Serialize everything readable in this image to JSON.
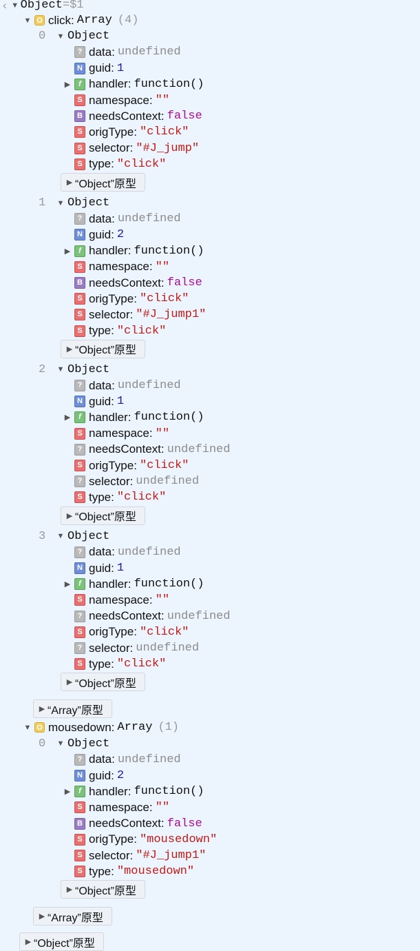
{
  "root": {
    "back_glyph": "‹",
    "label": "Object",
    "eq": "=",
    "var": "$1"
  },
  "groups": [
    {
      "name": "click",
      "type_label": "Array",
      "count": "(4)",
      "objects": [
        {
          "index": "0",
          "label": "Object",
          "props": [
            {
              "badge": "u",
              "key": "data:",
              "value": "undefined",
              "vclass": "v-undef"
            },
            {
              "badge": "N",
              "key": "guid:",
              "value": "1",
              "vclass": "v-num"
            },
            {
              "badge": "f",
              "key": "handler:",
              "value": "function()",
              "vclass": "v-fn",
              "expandable": true
            },
            {
              "badge": "S",
              "key": "namespace:",
              "value": "\"\"",
              "vclass": "v-str"
            },
            {
              "badge": "B",
              "key": "needsContext:",
              "value": "false",
              "vclass": "v-bool"
            },
            {
              "badge": "S",
              "key": "origType:",
              "value": "\"click\"",
              "vclass": "v-str"
            },
            {
              "badge": "S",
              "key": "selector:",
              "value": "\"#J_jump\"",
              "vclass": "v-str"
            },
            {
              "badge": "S",
              "key": "type:",
              "value": "\"click\"",
              "vclass": "v-str"
            }
          ]
        },
        {
          "index": "1",
          "label": "Object",
          "props": [
            {
              "badge": "u",
              "key": "data:",
              "value": "undefined",
              "vclass": "v-undef"
            },
            {
              "badge": "N",
              "key": "guid:",
              "value": "2",
              "vclass": "v-num"
            },
            {
              "badge": "f",
              "key": "handler:",
              "value": "function()",
              "vclass": "v-fn",
              "expandable": true
            },
            {
              "badge": "S",
              "key": "namespace:",
              "value": "\"\"",
              "vclass": "v-str"
            },
            {
              "badge": "B",
              "key": "needsContext:",
              "value": "false",
              "vclass": "v-bool"
            },
            {
              "badge": "S",
              "key": "origType:",
              "value": "\"click\"",
              "vclass": "v-str"
            },
            {
              "badge": "S",
              "key": "selector:",
              "value": "\"#J_jump1\"",
              "vclass": "v-str"
            },
            {
              "badge": "S",
              "key": "type:",
              "value": "\"click\"",
              "vclass": "v-str"
            }
          ]
        },
        {
          "index": "2",
          "label": "Object",
          "props": [
            {
              "badge": "u",
              "key": "data:",
              "value": "undefined",
              "vclass": "v-undef"
            },
            {
              "badge": "N",
              "key": "guid:",
              "value": "1",
              "vclass": "v-num"
            },
            {
              "badge": "f",
              "key": "handler:",
              "value": "function()",
              "vclass": "v-fn",
              "expandable": true
            },
            {
              "badge": "S",
              "key": "namespace:",
              "value": "\"\"",
              "vclass": "v-str"
            },
            {
              "badge": "u",
              "key": "needsContext:",
              "value": "undefined",
              "vclass": "v-undef"
            },
            {
              "badge": "S",
              "key": "origType:",
              "value": "\"click\"",
              "vclass": "v-str"
            },
            {
              "badge": "u",
              "key": "selector:",
              "value": "undefined",
              "vclass": "v-undef"
            },
            {
              "badge": "S",
              "key": "type:",
              "value": "\"click\"",
              "vclass": "v-str"
            }
          ]
        },
        {
          "index": "3",
          "label": "Object",
          "props": [
            {
              "badge": "u",
              "key": "data:",
              "value": "undefined",
              "vclass": "v-undef"
            },
            {
              "badge": "N",
              "key": "guid:",
              "value": "1",
              "vclass": "v-num"
            },
            {
              "badge": "f",
              "key": "handler:",
              "value": "function()",
              "vclass": "v-fn",
              "expandable": true
            },
            {
              "badge": "S",
              "key": "namespace:",
              "value": "\"\"",
              "vclass": "v-str"
            },
            {
              "badge": "u",
              "key": "needsContext:",
              "value": "undefined",
              "vclass": "v-undef"
            },
            {
              "badge": "S",
              "key": "origType:",
              "value": "\"click\"",
              "vclass": "v-str"
            },
            {
              "badge": "u",
              "key": "selector:",
              "value": "undefined",
              "vclass": "v-undef"
            },
            {
              "badge": "S",
              "key": "type:",
              "value": "\"click\"",
              "vclass": "v-str"
            }
          ]
        }
      ]
    },
    {
      "name": "mousedown",
      "type_label": "Array",
      "count": "(1)",
      "objects": [
        {
          "index": "0",
          "label": "Object",
          "props": [
            {
              "badge": "u",
              "key": "data:",
              "value": "undefined",
              "vclass": "v-undef"
            },
            {
              "badge": "N",
              "key": "guid:",
              "value": "2",
              "vclass": "v-num"
            },
            {
              "badge": "f",
              "key": "handler:",
              "value": "function()",
              "vclass": "v-fn",
              "expandable": true
            },
            {
              "badge": "S",
              "key": "namespace:",
              "value": "\"\"",
              "vclass": "v-str"
            },
            {
              "badge": "B",
              "key": "needsContext:",
              "value": "false",
              "vclass": "v-bool"
            },
            {
              "badge": "S",
              "key": "origType:",
              "value": "\"mousedown\"",
              "vclass": "v-str"
            },
            {
              "badge": "S",
              "key": "selector:",
              "value": "\"#J_jump1\"",
              "vclass": "v-str"
            },
            {
              "badge": "S",
              "key": "type:",
              "value": "\"mousedown\"",
              "vclass": "v-str"
            }
          ]
        }
      ]
    }
  ],
  "badge_glyphs": {
    "S": "S",
    "N": "N",
    "B": "B",
    "u": "?",
    "f": "f",
    "O": "O"
  },
  "labels": {
    "object_proto": "“Object”原型",
    "array_proto": "“Array”原型"
  },
  "icons": {
    "expanded": "disclosure-triangle-expanded-icon",
    "collapsed": "disclosure-triangle-collapsed-icon",
    "back": "back-chevron-icon"
  }
}
